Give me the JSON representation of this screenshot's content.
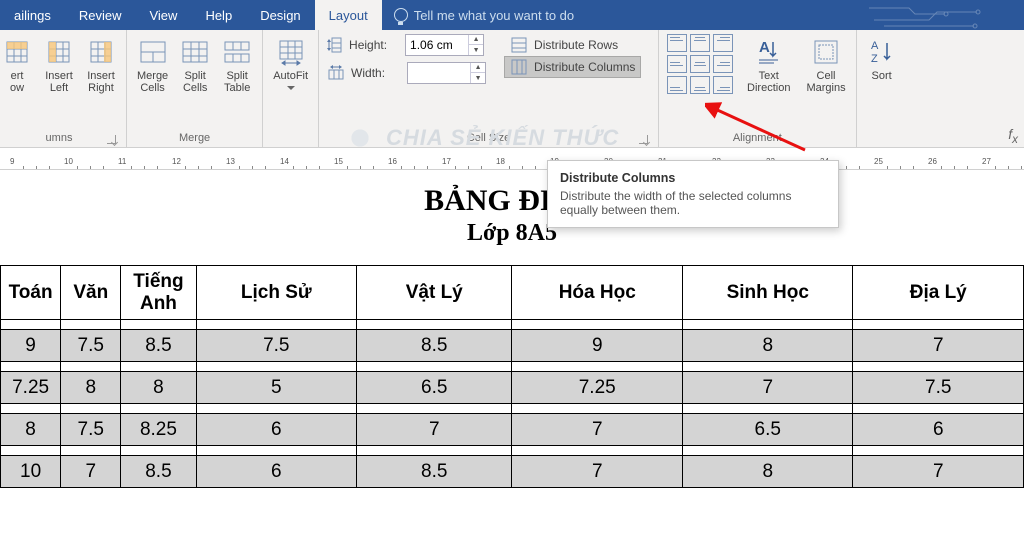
{
  "tabs": [
    "ailings",
    "Review",
    "View",
    "Help",
    "Design",
    "Layout"
  ],
  "tellme": "Tell me what you want to do",
  "ribbon": {
    "insert_above": "ert\now",
    "insert_below": "Insert\nLeft",
    "insert_right": "Insert\nRight",
    "rowscols_label": "umns",
    "merge": "Merge\nCells",
    "split": "Split\nCells",
    "split_table": "Split\nTable",
    "merge_label": "Merge",
    "autofit": "AutoFit",
    "height_label": "Height:",
    "height_val": "1.06 cm",
    "width_label": "Width:",
    "width_val": "",
    "dist_rows": "Distribute Rows",
    "dist_cols": "Distribute Columns",
    "cellsize_label": "Cell Size",
    "text_dir": "Text\nDirection",
    "cell_marg": "Cell\nMargins",
    "align_label": "Alignment",
    "sort": "Sort"
  },
  "tooltip": {
    "title": "Distribute Columns",
    "body": "Distribute the width of the selected columns equally between them."
  },
  "ruler_nums": [
    "9",
    "10",
    "11",
    "12",
    "13",
    "14",
    "15",
    "16",
    "17",
    "18",
    "19",
    "20",
    "21",
    "22",
    "23",
    "24",
    "25",
    "26",
    "27"
  ],
  "doc": {
    "title": "BẢNG ĐIỂM",
    "subtitle": "Lớp 8A5",
    "headers": [
      "Toán",
      "Văn",
      "Tiếng Anh",
      "Lịch Sử",
      "Vật Lý",
      "Hóa Học",
      "Sinh Học",
      "Địa Lý"
    ],
    "rows": [
      [
        "9",
        "7.5",
        "8.5",
        "7.5",
        "8.5",
        "9",
        "8",
        "7"
      ],
      [
        "7.25",
        "8",
        "8",
        "5",
        "6.5",
        "7.25",
        "7",
        "7.5"
      ],
      [
        "8",
        "7.5",
        "8.25",
        "6",
        "7",
        "7",
        "6.5",
        "6"
      ],
      [
        "10",
        "7",
        "8.5",
        "6",
        "8.5",
        "7",
        "8",
        "7"
      ]
    ]
  },
  "watermark": "CHIA SẺ KIẾN THỨC"
}
